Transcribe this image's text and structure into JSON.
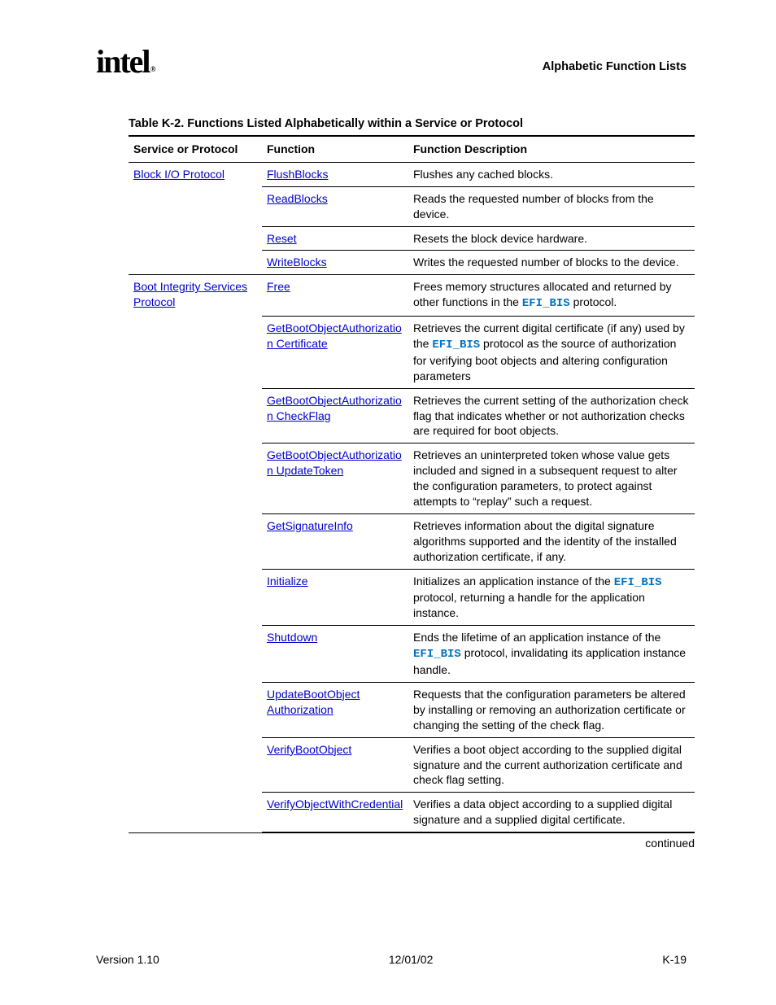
{
  "header": {
    "logo_text": "intel",
    "section_title": "Alphabetic Function Lists"
  },
  "table": {
    "caption": "Table K-2.  Functions Listed Alphabetically within a Service or Protocol",
    "columns": [
      "Service or Protocol",
      "Function",
      "Function Description"
    ],
    "groups": [
      {
        "service_link": "Block I/O Protocol",
        "rows": [
          {
            "func": "FlushBlocks",
            "desc": "Flushes any cached blocks."
          },
          {
            "func": "ReadBlocks",
            "desc": "Reads the requested number of blocks from the device."
          },
          {
            "func": "Reset",
            "desc": "Resets the block device hardware."
          },
          {
            "func": "WriteBlocks",
            "desc": "Writes the requested number of blocks to the device."
          }
        ]
      },
      {
        "service_link": "Boot Integrity Services Protocol",
        "rows": [
          {
            "func": "Free",
            "desc_parts": [
              "Frees memory structures allocated and returned by other functions in the ",
              {
                "code": "EFI_BIS"
              },
              " protocol."
            ]
          },
          {
            "func": "GetBootObjectAuthorization Certificate",
            "desc_parts": [
              "Retrieves the current digital certificate (if any) used by the ",
              {
                "code": "EFI_BIS"
              },
              " protocol as the source of authorization for verifying boot objects and altering configuration parameters"
            ]
          },
          {
            "func": "GetBootObjectAuthorization CheckFlag",
            "desc": "Retrieves the current setting of the authorization check flag that indicates whether or not authorization checks are required for boot objects."
          },
          {
            "func": "GetBootObjectAuthorization UpdateToken",
            "desc": "Retrieves an uninterpreted token whose value gets included and signed in a subsequent request to alter the configuration parameters, to protect against attempts to “replay” such a request."
          },
          {
            "func": "GetSignatureInfo",
            "desc": "Retrieves information about the digital signature algorithms supported and the identity of the installed authorization certificate, if any."
          },
          {
            "func": "Initialize",
            "desc_parts": [
              "Initializes an application instance of the ",
              {
                "code": "EFI_BIS"
              },
              " protocol, returning a handle for the application instance."
            ]
          },
          {
            "func": "Shutdown",
            "desc_parts": [
              "Ends the lifetime of an application instance of the ",
              {
                "code": "EFI_BIS"
              },
              " protocol, invalidating its application instance handle."
            ]
          },
          {
            "func": "UpdateBootObject Authorization",
            "desc": "Requests that the configuration parameters be altered by installing or removing an authorization certificate or changing the setting of the check flag."
          },
          {
            "func": "VerifyBootObject",
            "desc": "Verifies a boot object according to the supplied digital signature and the current authorization certificate and check flag setting."
          },
          {
            "func": "VerifyObjectWithCredential",
            "desc": "Verifies a data object according to a supplied digital signature and a supplied digital certificate."
          }
        ]
      }
    ],
    "continued_label": "continued"
  },
  "footer": {
    "left": "Version 1.10",
    "center": "12/01/02",
    "right": "K-19"
  }
}
